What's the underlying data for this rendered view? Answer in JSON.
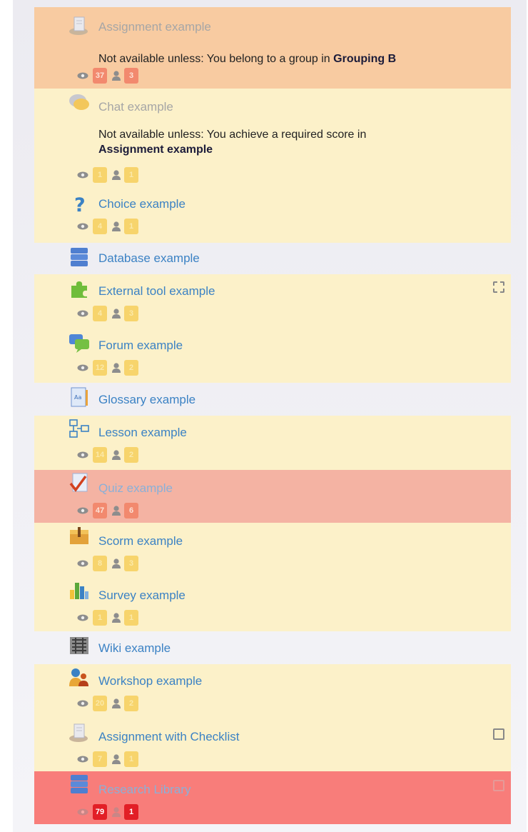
{
  "items": [
    {
      "name": "Assignment example",
      "icon": "assignment-icon",
      "availability": [
        "Not available unless: You belong to a group in ",
        "Grouping B"
      ],
      "views": "37",
      "users": "3"
    },
    {
      "name": "Chat example",
      "icon": "chat-icon",
      "availability": [
        "Not available unless: You achieve a required score in ",
        "Assignment example"
      ],
      "views": "1",
      "users": "1"
    },
    {
      "name": "Choice example",
      "icon": "choice-icon",
      "views": "4",
      "users": "1"
    },
    {
      "name": "Database example",
      "icon": "database-icon"
    },
    {
      "name": "External tool example",
      "icon": "puzzle-icon",
      "views": "4",
      "users": "3"
    },
    {
      "name": "Forum example",
      "icon": "forum-icon",
      "views": "12",
      "users": "2"
    },
    {
      "name": "Glossary example",
      "icon": "glossary-icon"
    },
    {
      "name": "Lesson example",
      "icon": "lesson-icon",
      "views": "14",
      "users": "2"
    },
    {
      "name": "Quiz example",
      "icon": "quiz-icon",
      "views": "47",
      "users": "6"
    },
    {
      "name": "Scorm example",
      "icon": "scorm-icon",
      "views": "8",
      "users": "3"
    },
    {
      "name": "Survey example",
      "icon": "survey-icon",
      "views": "1",
      "users": "1"
    },
    {
      "name": "Wiki example",
      "icon": "wiki-icon"
    },
    {
      "name": "Workshop example",
      "icon": "workshop-icon",
      "views": "20",
      "users": "2"
    },
    {
      "name": "Assignment with Checklist",
      "icon": "assignment-icon",
      "views": "7",
      "users": "1"
    },
    {
      "name": "Research Library",
      "icon": "database-icon",
      "views": "79",
      "users": "1"
    }
  ],
  "colors": {
    "orange": "#f8cba1",
    "cream": "#fcf1c9",
    "pink": "#f4b3a3",
    "red": "#f87d7a",
    "link": "#3b82c4",
    "badge_yellow": "#f7d46c",
    "badge_salmon": "#f2896e",
    "badge_red": "#e21f26"
  }
}
